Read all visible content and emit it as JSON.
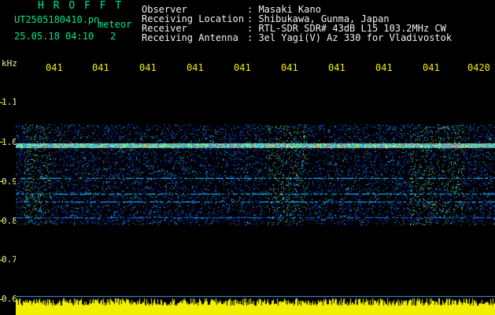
{
  "app": {
    "name": "H R O F F T",
    "file": "UT2505180410.pn",
    "mode": "meteor",
    "datetime": "25.05.18 04:10",
    "page": "2"
  },
  "station": {
    "labels": [
      "Observer",
      "Receiving Location",
      "Receiver",
      "Receiving Antenna"
    ],
    "values": [
      ": Masaki Kano",
      ": Shibukawa, Gunma, Japan",
      ": RTL-SDR SDR# 43dB L15 103.2MHz CW",
      ": 3el Yagi(V) Az 330 for Vladivostok"
    ]
  },
  "axis": {
    "unit": "kHz",
    "y_ticks": [
      "1.1",
      "1.0",
      "0.9",
      "0.8",
      "0.7",
      "0.6"
    ],
    "time_ticks": [
      "041",
      "041",
      "041",
      "041",
      "041",
      "041",
      "041",
      "041",
      "041",
      "0420"
    ]
  },
  "colors": {
    "header_green": "#00e68a",
    "axis_yellow": "#f0f000",
    "background": "#000000"
  }
}
